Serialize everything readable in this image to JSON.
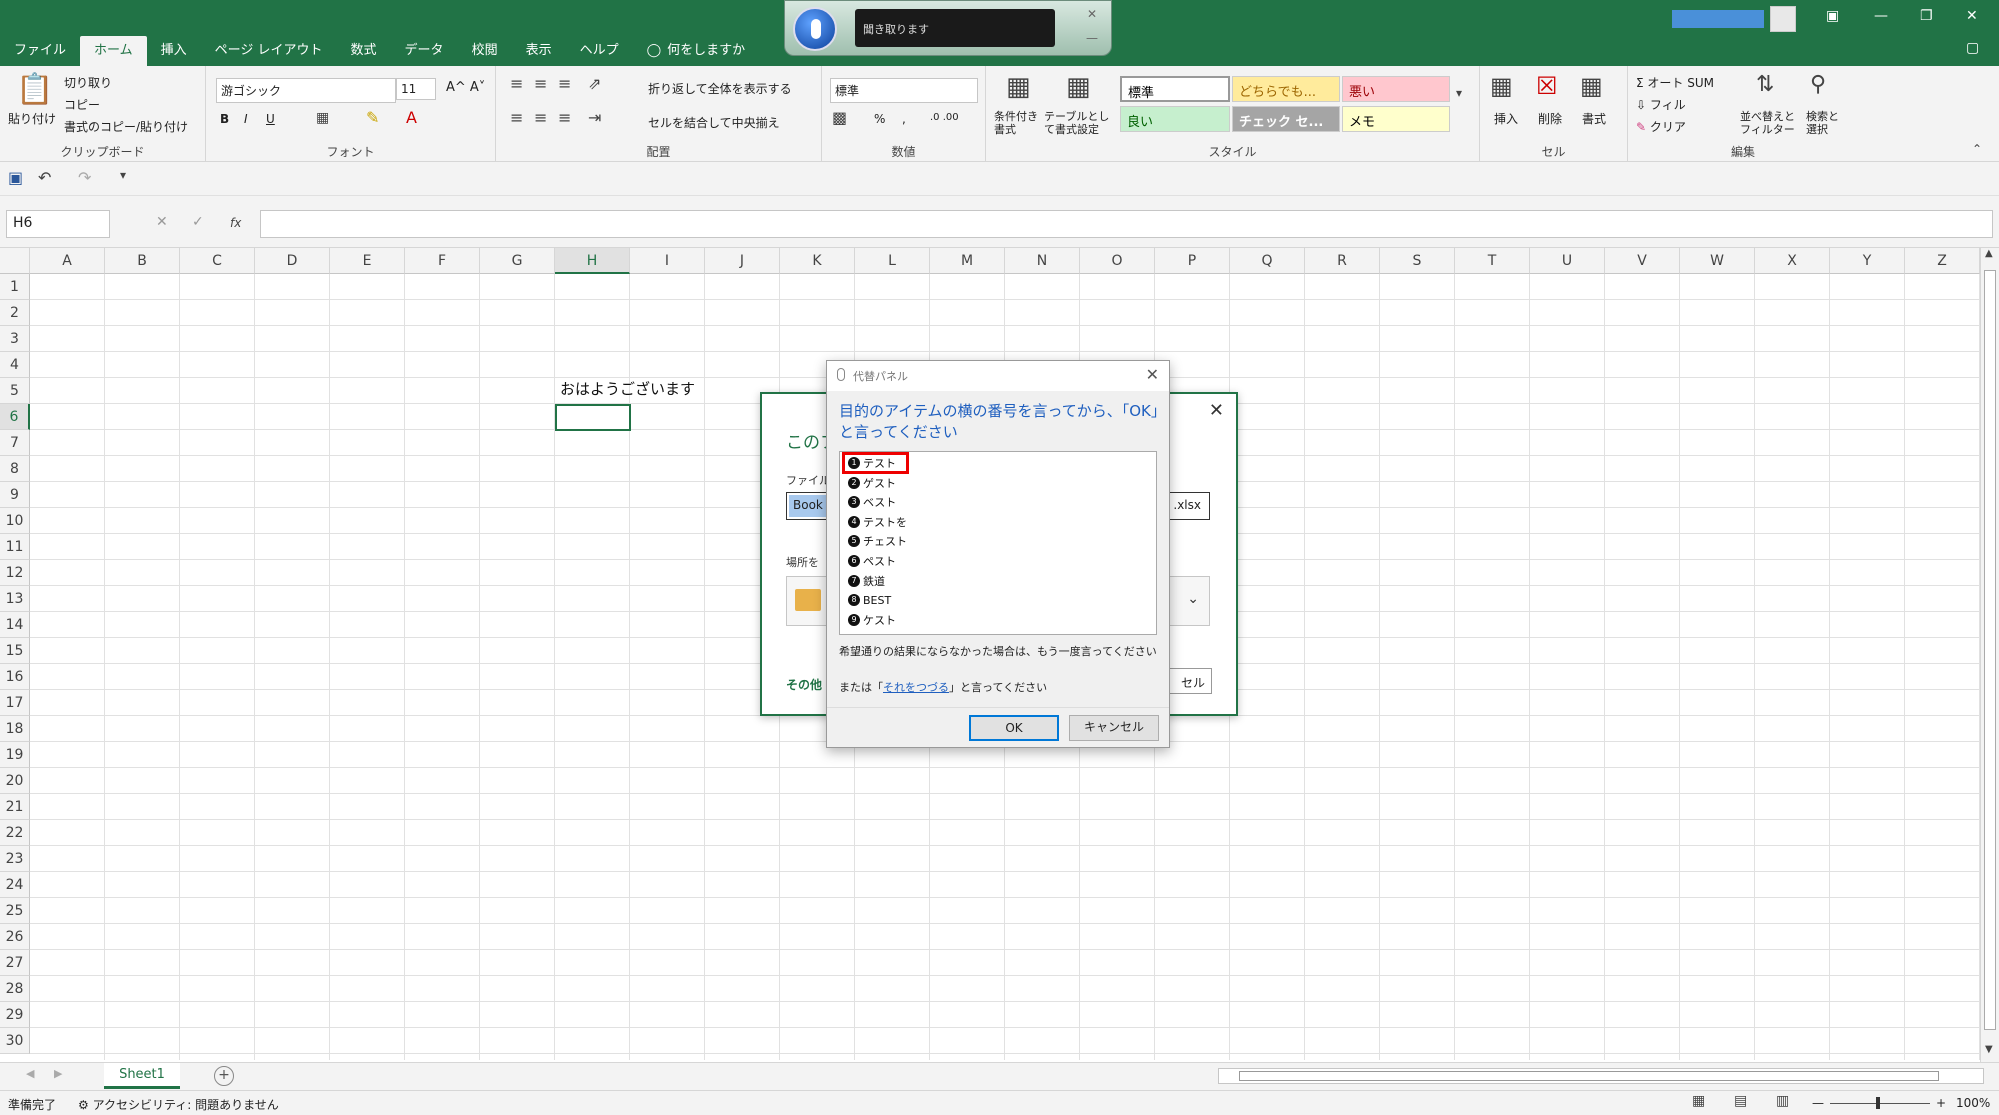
{
  "ribbon_tabs": [
    "ファイル",
    "ホーム",
    "挿入",
    "ページ レイアウト",
    "数式",
    "データ",
    "校閲",
    "表示",
    "ヘルプ"
  ],
  "active_tab": "ホーム",
  "tell_me": "何をしますか",
  "speech_widget": {
    "message": "聞き取ります"
  },
  "ribbon": {
    "clipboard": {
      "paste": "貼り付け",
      "cut": "切り取り",
      "copy": "コピー",
      "format_painter": "書式のコピー/貼り付け",
      "label": "クリップボード"
    },
    "font": {
      "name": "游ゴシック",
      "size": "11",
      "bold": "B",
      "italic": "I",
      "underline": "U",
      "label": "フォント"
    },
    "alignment": {
      "wrap": "折り返して全体を表示する",
      "merge": "セルを結合して中央揃え",
      "label": "配置"
    },
    "number": {
      "format": "標準",
      "percent": "%",
      "comma": ",",
      "label": "数値"
    },
    "styles": {
      "conditional": "条件付き書式",
      "table": "テーブルとして書式設定",
      "label": "スタイル",
      "cells": [
        {
          "text": "標準",
          "bg": "#ffffff",
          "fg": "#000000"
        },
        {
          "text": "どちらでも...",
          "bg": "#ffeb9c",
          "fg": "#9c6500"
        },
        {
          "text": "悪い",
          "bg": "#ffc7ce",
          "fg": "#9c0006"
        },
        {
          "text": "良い",
          "bg": "#c6efce",
          "fg": "#006100"
        },
        {
          "text": "チェック セ...",
          "bg": "#a5a5a5",
          "fg": "#ffffff"
        },
        {
          "text": "メモ",
          "bg": "#ffffcc",
          "fg": "#000000"
        }
      ]
    },
    "cells": {
      "insert": "挿入",
      "delete": "削除",
      "format": "書式",
      "label": "セル"
    },
    "editing": {
      "autosum": "オート SUM",
      "fill": "フィル",
      "clear": "クリア",
      "sort": "並べ替えとフィルター",
      "find": "検索と選択",
      "label": "編集"
    }
  },
  "formula_bar": {
    "name_box": "H6",
    "fx": "fx",
    "value": ""
  },
  "columns": [
    "A",
    "B",
    "C",
    "D",
    "E",
    "F",
    "G",
    "H",
    "I",
    "J",
    "K",
    "L",
    "M",
    "N",
    "O",
    "P",
    "Q",
    "R",
    "S",
    "T",
    "U",
    "V",
    "W",
    "X",
    "Y",
    "Z"
  ],
  "selected_column": "H",
  "rows": [
    "1",
    "2",
    "3",
    "4",
    "5",
    "6",
    "7",
    "8",
    "9",
    "10",
    "11",
    "12",
    "13",
    "14",
    "15",
    "16",
    "17",
    "18",
    "19",
    "20",
    "21",
    "22",
    "23",
    "24",
    "25",
    "26",
    "27",
    "28",
    "29",
    "30"
  ],
  "selected_row": "6",
  "cell_H5": "おはようございます",
  "save_dialog": {
    "title": "このフ",
    "file_label": "ファイル",
    "file_value": "Book",
    "file_ext": ".xlsx",
    "location_label": "場所を",
    "other": "その他",
    "cancel_partial": "セル"
  },
  "alternates_panel": {
    "title": "代替パネル",
    "instruction": "目的のアイテムの横の番号を言ってから、「OK」と言ってください",
    "items": [
      {
        "n": "1",
        "text": "テスト"
      },
      {
        "n": "2",
        "text": "ゲスト"
      },
      {
        "n": "3",
        "text": "ベスト"
      },
      {
        "n": "4",
        "text": "テストを"
      },
      {
        "n": "5",
        "text": "チェスト"
      },
      {
        "n": "6",
        "text": "ペスト"
      },
      {
        "n": "7",
        "text": "鉄道"
      },
      {
        "n": "8",
        "text": "BEST"
      },
      {
        "n": "9",
        "text": "ケスト"
      }
    ],
    "note": "希望通りの結果にならなかった場合は、もう一度言ってください",
    "note2_prefix": "または「",
    "note2_link": "それをつづる",
    "note2_suffix": "」と言ってください",
    "ok": "OK",
    "cancel": "キャンセル"
  },
  "sheet_tab": "Sheet1",
  "status": {
    "ready": "準備完了",
    "accessibility": "アクセシビリティ: 問題ありません",
    "zoom": "100%"
  }
}
